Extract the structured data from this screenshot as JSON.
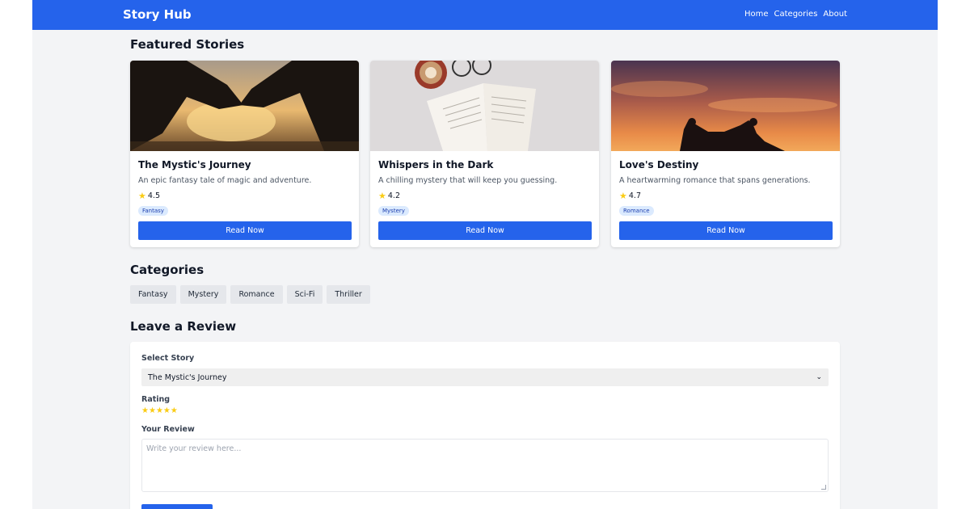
{
  "header": {
    "brand": "Story Hub",
    "links": [
      "Home",
      "Categories",
      "About"
    ]
  },
  "featured": {
    "title": "Featured Stories",
    "stories": [
      {
        "title": "The Mystic's Journey",
        "description": "An epic fantasy tale of magic and adventure.",
        "rating": "4.5",
        "genre": "Fantasy",
        "button": "Read Now"
      },
      {
        "title": "Whispers in the Dark",
        "description": "A chilling mystery that will keep you guessing.",
        "rating": "4.2",
        "genre": "Mystery",
        "button": "Read Now"
      },
      {
        "title": "Love's Destiny",
        "description": "A heartwarming romance that spans generations.",
        "rating": "4.7",
        "genre": "Romance",
        "button": "Read Now"
      }
    ]
  },
  "categories": {
    "title": "Categories",
    "items": [
      "Fantasy",
      "Mystery",
      "Romance",
      "Sci-Fi",
      "Thriller"
    ]
  },
  "review": {
    "title": "Leave a Review",
    "select_label": "Select Story",
    "selected_story": "The Mystic's Journey",
    "rating_label": "Rating",
    "rating_value": 5,
    "review_label": "Your Review",
    "review_placeholder": "Write your review here..."
  },
  "colors": {
    "primary": "#2563eb",
    "background": "#f3f4f6",
    "star": "#facc15",
    "badge_bg": "#dbeafe"
  }
}
